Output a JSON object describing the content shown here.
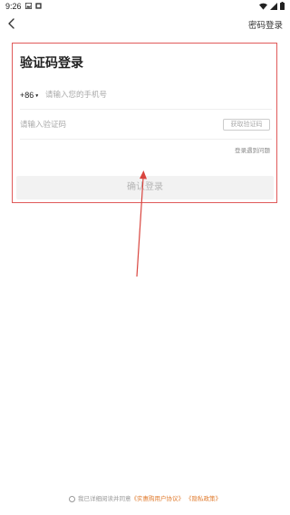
{
  "status_bar": {
    "time": "9:26",
    "icons_left": [
      "image-icon",
      "notification-icon"
    ],
    "icons_right": [
      "wifi-icon",
      "signal-icon",
      "battery-icon"
    ]
  },
  "nav": {
    "back_icon": "chevron-left-icon",
    "password_login": "密码登录"
  },
  "form": {
    "title": "验证码登录",
    "country_code": "+86",
    "phone_placeholder": "请输入您的手机号",
    "code_placeholder": "请输入验证码",
    "get_code_label": "获取验证码",
    "login_issue": "登录遇到问题",
    "confirm_label": "确认登录"
  },
  "agreement": {
    "prefix": "我已详细阅读并同意",
    "user_agreement": "《实惠购用户协议》",
    "privacy_policy": "《隐私政策》"
  },
  "annotation": {
    "highlight_color": "#e05a5a",
    "arrow_color": "#d9453f"
  }
}
